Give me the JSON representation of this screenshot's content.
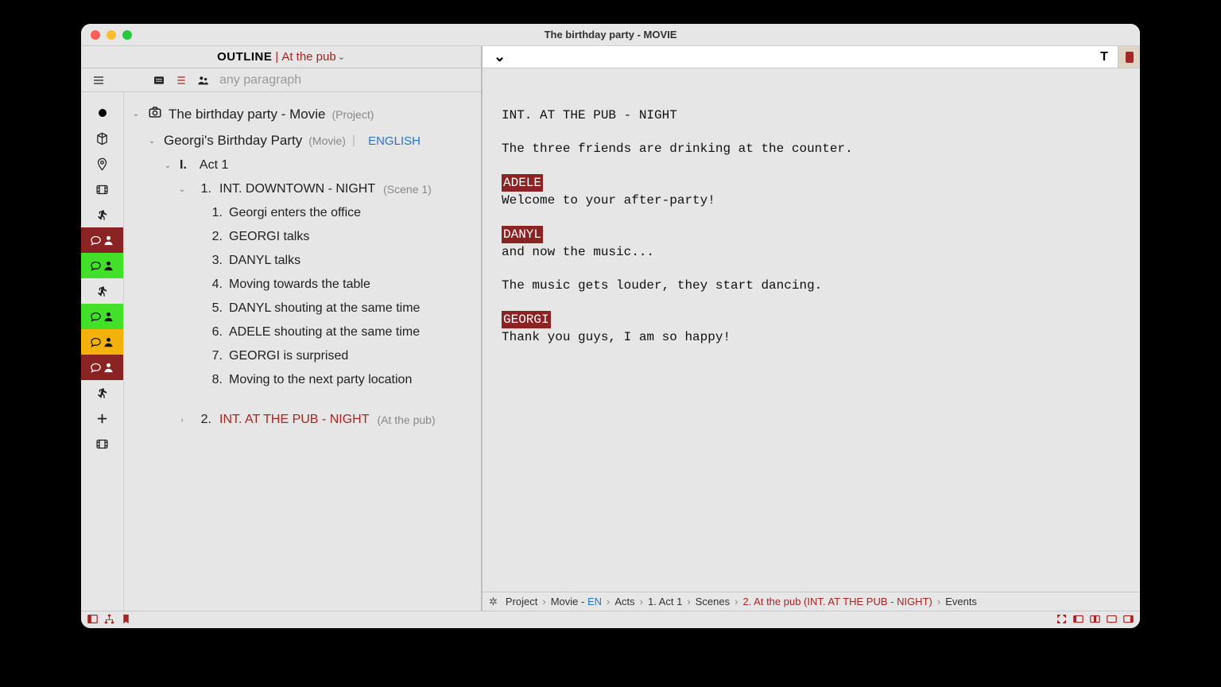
{
  "window": {
    "title": "The birthday party - MOVIE"
  },
  "outline": {
    "label": "OUTLINE",
    "context": "At the pub",
    "search_placeholder": "any paragraph"
  },
  "project": {
    "title": "The birthday party - Movie",
    "meta": "(Project)"
  },
  "movie": {
    "title": "Georgi's Birthday Party",
    "meta": "(Movie)",
    "language": "ENGLISH"
  },
  "act": {
    "roman": "I.",
    "title": "Act 1"
  },
  "scenes": [
    {
      "num": "1.",
      "slug": "INT.  DOWNTOWN - NIGHT",
      "meta": "(Scene 1)",
      "highlighted": false,
      "expanded": true,
      "beats": [
        {
          "num": "1.",
          "text": "Georgi enters the office"
        },
        {
          "num": "2.",
          "text": "GEORGI talks"
        },
        {
          "num": "3.",
          "text": "DANYL talks"
        },
        {
          "num": "4.",
          "text": "Moving towards the table"
        },
        {
          "num": "5.",
          "text": "DANYL shouting at the same time"
        },
        {
          "num": "6.",
          "text": "ADELE shouting at the same time"
        },
        {
          "num": "7.",
          "text": "GEORGI is surprised"
        },
        {
          "num": "8.",
          "text": "Moving to the next party location"
        }
      ]
    },
    {
      "num": "2.",
      "slug": "INT.  AT THE PUB - NIGHT",
      "meta": "(At the pub)",
      "highlighted": true,
      "expanded": false,
      "beats": []
    }
  ],
  "script": {
    "slug": "INT. AT THE PUB - NIGHT",
    "blocks": [
      {
        "type": "action",
        "text": "The three friends are drinking at the counter."
      },
      {
        "type": "dialogue",
        "char": "ADELE",
        "text": "Welcome to your after-party!"
      },
      {
        "type": "dialogue",
        "char": "DANYL",
        "text": "and now the music..."
      },
      {
        "type": "action",
        "text": "The music gets louder, they start dancing."
      },
      {
        "type": "dialogue",
        "char": "GEORGI",
        "text": "Thank you guys, I am so happy!"
      }
    ]
  },
  "breadcrumb": {
    "project": "Project",
    "movie_prefix": "Movie - ",
    "movie_lang": "EN",
    "acts": "Acts",
    "act": "1. Act 1",
    "scenes": "Scenes",
    "scene": "2. At the pub (INT.  AT THE PUB - NIGHT)",
    "events": "Events"
  },
  "gutter": [
    {
      "type": "dot"
    },
    {
      "type": "cube"
    },
    {
      "type": "pin"
    },
    {
      "type": "film"
    },
    {
      "type": "runner"
    },
    {
      "type": "bubble",
      "bg": "red"
    },
    {
      "type": "bubble",
      "bg": "green"
    },
    {
      "type": "runner"
    },
    {
      "type": "bubble",
      "bg": "green"
    },
    {
      "type": "bubble",
      "bg": "orange"
    },
    {
      "type": "bubble",
      "bg": "red"
    },
    {
      "type": "runner"
    },
    {
      "type": "plus"
    },
    {
      "type": "film"
    }
  ],
  "toolbar_right": {
    "t": "T"
  }
}
